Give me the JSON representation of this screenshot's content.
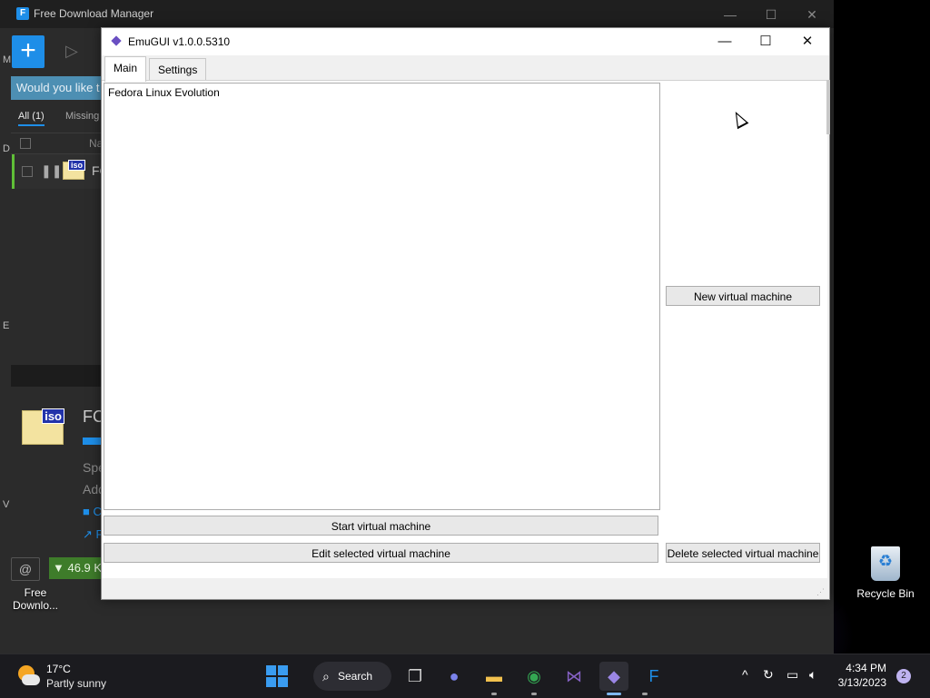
{
  "fdm": {
    "title": "Free Download Manager",
    "notice_text": "Would you like t",
    "tab_all": "All (1)",
    "tab_missing": "Missing f",
    "col_name": "Na",
    "row_name": "FC",
    "iso_tag": "iso",
    "detail_name": "FC",
    "detail_speed": "Spe",
    "detail_added": "Add",
    "detail_link1": "C",
    "detail_link2": "F",
    "speed_text": "▼ 46.9 K",
    "left_chars": [
      "M",
      "D",
      "E",
      "V"
    ]
  },
  "desktop": {
    "fdm_shortcut_label_1": "Free",
    "fdm_shortcut_label_2": "Downlo...",
    "recycle_bin_label": "Recycle Bin"
  },
  "emugui": {
    "title": "EmuGUI v1.0.0.5310",
    "tabs": [
      {
        "label": "Main",
        "active": true
      },
      {
        "label": "Settings",
        "active": false
      }
    ],
    "vm_list": [
      "Fedora Linux Evolution"
    ],
    "buttons": {
      "new_vm": "New virtual machine",
      "start_vm": "Start virtual machine",
      "edit_vm": "Edit selected virtual machine",
      "delete_vm": "Delete selected virtual machine"
    }
  },
  "taskbar": {
    "weather_temp": "17°C",
    "weather_cond": "Partly sunny",
    "search_label": "Search",
    "pinned_icons": [
      "start-icon",
      "search-icon",
      "task-view-icon",
      "teams-chat-icon",
      "file-explorer-icon",
      "chrome-icon",
      "visual-studio-icon",
      "emugui-icon",
      "fdm-icon"
    ],
    "time": "4:34 PM",
    "date": "3/13/2023",
    "notification_count": "2"
  },
  "colors": {
    "accent": "#1e8ee8",
    "fdm_bg": "#2b2b2b",
    "taskbar_bg": "#1b1b1f",
    "progress_green": "#5fbf37"
  }
}
